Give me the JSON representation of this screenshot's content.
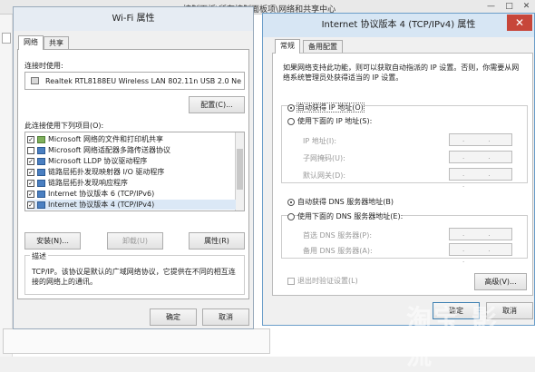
{
  "background": {
    "title": "控制面板\\所有控制面板项\\网络和共享中心",
    "minimize": "—",
    "maximize": "□",
    "close": "✕",
    "footer_ok": "确定",
    "footer_cancel": "取消"
  },
  "wifi_dialog": {
    "title": "Wi-Fi 属性",
    "tabs": [
      "网络",
      "共享"
    ],
    "connect_using_label": "连接时使用:",
    "adapter_name": "Realtek RTL8188EU Wireless LAN 802.11n USB 2.0 Netw",
    "configure_button": "配置(C)...",
    "items_label": "此连接使用下列项目(O):",
    "items": [
      {
        "label": "Microsoft 网络的文件和打印机共享",
        "checked": true
      },
      {
        "label": "Microsoft 网络适配器多路传送器协议",
        "checked": false
      },
      {
        "label": "Microsoft LLDP 协议驱动程序",
        "checked": true
      },
      {
        "label": "链路层拓扑发现映射器 I/O 驱动程序",
        "checked": true
      },
      {
        "label": "链路层拓扑发现响应程序",
        "checked": true
      },
      {
        "label": "Internet 协议版本 6 (TCP/IPv6)",
        "checked": true
      },
      {
        "label": "Internet 协议版本 4 (TCP/IPv4)",
        "checked": true
      }
    ],
    "install_button": "安装(N)...",
    "uninstall_button": "卸载(U)",
    "properties_button": "属性(R)",
    "description_label": "描述",
    "description_text": "TCP/IP。该协议是默认的广域网络协议，它提供在不同的相互连接的网络上的通讯。",
    "ok_button": "确定",
    "cancel_button": "取消"
  },
  "ipv4_dialog": {
    "title": "Internet 协议版本 4 (TCP/IPv4) 属性",
    "close": "✕",
    "tabs": [
      "常规",
      "备用配置"
    ],
    "intro": "如果网络支持此功能，则可以获取自动指派的 IP 设置。否则，你需要从网络系统管理员处获得适当的 IP 设置。",
    "auto_ip": "自动获得 IP 地址(O)",
    "manual_ip": "使用下面的 IP 地址(S):",
    "ip_address": "IP 地址(I):",
    "subnet_mask": "子网掩码(U):",
    "default_gateway": "默认网关(D):",
    "auto_dns": "自动获得 DNS 服务器地址(B)",
    "manual_dns": "使用下面的 DNS 服务器地址(E):",
    "preferred_dns": "首选 DNS 服务器(P):",
    "alternate_dns": "备用 DNS 服务器(A):",
    "ip_placeholder": ". . .",
    "validate_on_exit": "退出时验证设置(L)",
    "advanced_button": "高级(V)...",
    "ok_button": "确定",
    "cancel_button": "取消",
    "selected_ip_mode": "auto",
    "selected_dns_mode": "auto"
  },
  "watermark": {
    "brand": "淘宝 影 流",
    "url": "bangpai.taobao.com"
  }
}
